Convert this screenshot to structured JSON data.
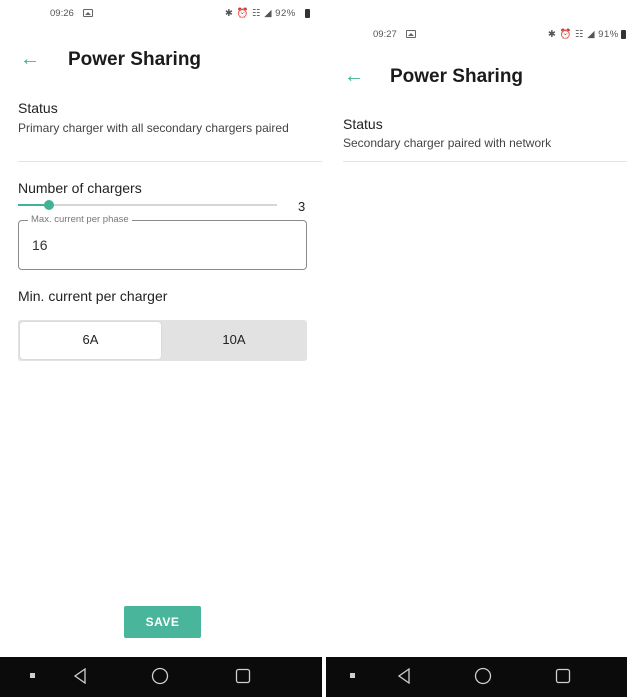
{
  "left_screen": {
    "status_bar": {
      "time": "09:26",
      "icons": "✱ ⏰ ☷ ◢ 92%"
    },
    "app_bar": {
      "back_icon": "arrow-left-icon",
      "title": "Power Sharing"
    },
    "status": {
      "label": "Status",
      "value": "Primary charger with all secondary chargers paired"
    },
    "chargers": {
      "label": "Number of chargers",
      "value": "3",
      "slider_fraction": 0.12
    },
    "max_current": {
      "legend": "Max. current per phase",
      "value": "16"
    },
    "min_current": {
      "label": "Min. current per charger",
      "options": [
        "6A",
        "10A"
      ],
      "selected": "6A"
    },
    "save_button": "SAVE"
  },
  "right_screen": {
    "status_bar": {
      "time": "09:27",
      "icons": "✱ ⏰ ☷ ◢ 91%"
    },
    "app_bar": {
      "back_icon": "arrow-left-icon",
      "title": "Power Sharing"
    },
    "status": {
      "label": "Status",
      "value": "Secondary charger paired with network"
    }
  },
  "navbar": {
    "icons": [
      "square-dot-icon",
      "back-triangle-icon",
      "home-circle-icon",
      "recents-square-icon"
    ]
  },
  "colors": {
    "accent": "#3fb394",
    "save_button": "#49b59b",
    "navbar": "#0b0b0b",
    "segment_bg": "#e2e2e2"
  }
}
